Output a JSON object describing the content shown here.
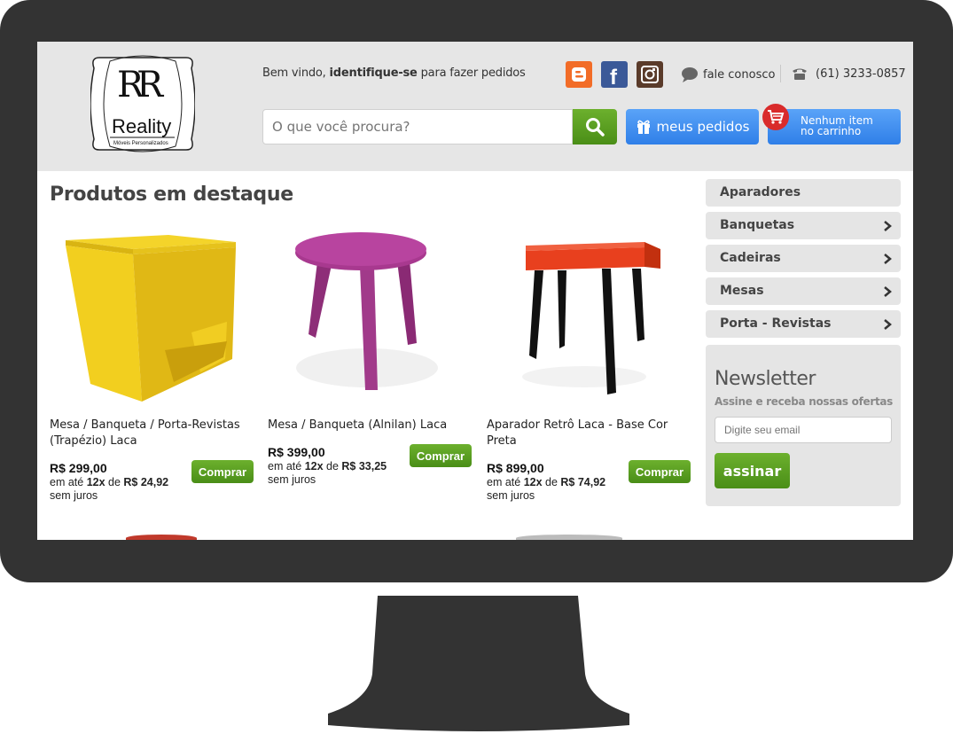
{
  "header": {
    "logo": {
      "brand": "Reality",
      "tagline": "Móveis Personalizados"
    },
    "welcome_prefix": "Bem vindo, ",
    "welcome_link": "identifique-se",
    "welcome_suffix": " para fazer pedidos",
    "contact_label": "fale conosco",
    "phone": "(61) 3233-0857",
    "social": [
      "blogger-icon",
      "facebook-icon",
      "instagram-icon"
    ],
    "search_placeholder": "O que você procura?",
    "orders_label": "meus pedidos",
    "cart_line1": "Nenhum item",
    "cart_line2": "no carrinho"
  },
  "main": {
    "section_title": "Produtos em destaque",
    "products": [
      {
        "name": "Mesa / Banqueta / Porta-Revistas (Trapézio) Laca",
        "price": "R$ 299,00",
        "inst_prefix": "em até ",
        "inst_times": "12x",
        "inst_de": " de ",
        "inst_value": "R$ 24,92",
        "inst_suffix": "sem juros",
        "buy": "Comprar"
      },
      {
        "name": "Mesa / Banqueta (Alnilan) Laca",
        "price": "R$ 399,00",
        "inst_prefix": "em até ",
        "inst_times": "12x",
        "inst_de": " de ",
        "inst_value": "R$ 33,25",
        "inst_suffix": "sem juros",
        "buy": "Comprar"
      },
      {
        "name": "Aparador Retrô Laca - Base Cor Preta",
        "price": "R$ 899,00",
        "inst_prefix": "em até ",
        "inst_times": "12x",
        "inst_de": " de ",
        "inst_value": "R$ 74,92",
        "inst_suffix": "sem juros",
        "buy": "Comprar"
      }
    ]
  },
  "sidebar": {
    "categories": [
      "Aparadores",
      "Banquetas",
      "Cadeiras",
      "Mesas",
      "Porta - Revistas"
    ],
    "newsletter": {
      "title": "Newsletter",
      "subtitle": "Assine e receba nossas ofertas",
      "placeholder": "Digite seu email",
      "button": "assinar"
    }
  },
  "colors": {
    "green": "#5a9e22",
    "blue": "#3c8ef0",
    "bezel": "#333333",
    "header_bg": "#e6e6e6"
  }
}
